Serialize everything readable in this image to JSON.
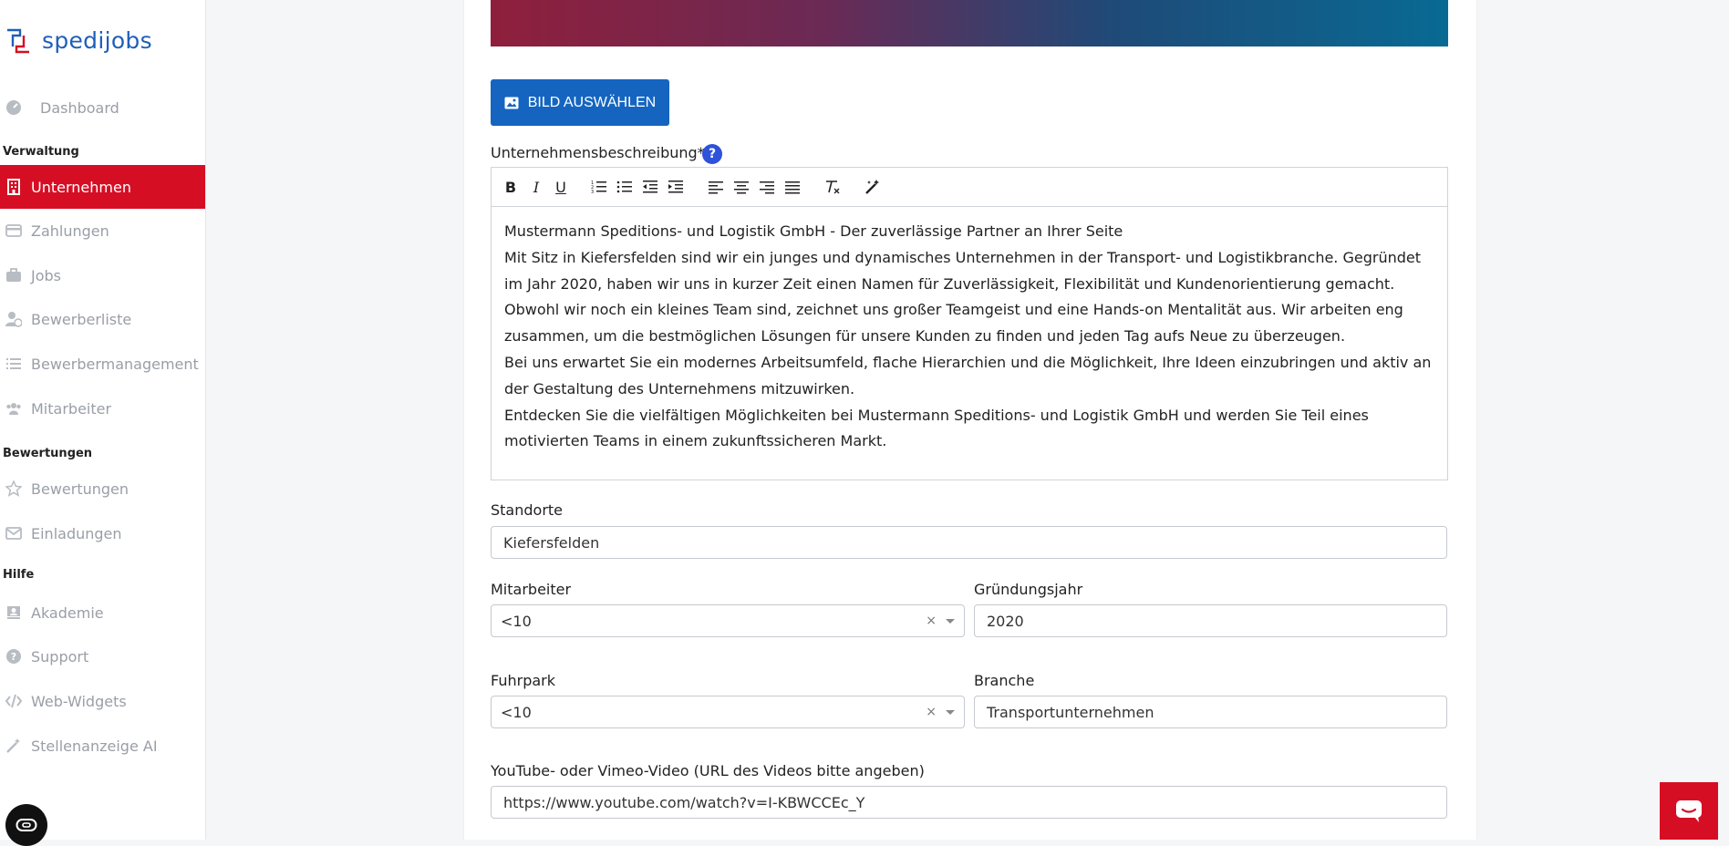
{
  "brand": {
    "name": "spedijobs",
    "accent": "#d60e24",
    "primary": "#1565c0"
  },
  "sidebar": {
    "dashboard": "Dashboard",
    "sections": {
      "verwaltung": "Verwaltung",
      "bewertungen": "Bewertungen",
      "hilfe": "Hilfe"
    },
    "items": [
      {
        "label": "Unternehmen",
        "icon": "building-icon",
        "active": true
      },
      {
        "label": "Zahlungen",
        "icon": "credit-card-icon"
      },
      {
        "label": "Jobs",
        "icon": "briefcase-icon"
      },
      {
        "label": "Bewerberliste",
        "icon": "user-clock-icon"
      },
      {
        "label": "Bewerbermanagement",
        "icon": "list-icon"
      },
      {
        "label": "Mitarbeiter",
        "icon": "users-icon"
      },
      {
        "label": "Bewertungen",
        "icon": "star-icon"
      },
      {
        "label": "Einladungen",
        "icon": "envelope-icon"
      },
      {
        "label": "Akademie",
        "icon": "graduation-cap-icon"
      },
      {
        "label": "Support",
        "icon": "question-circle-icon"
      },
      {
        "label": "Web-Widgets",
        "icon": "code-icon"
      },
      {
        "label": "Stellenanzeige AI",
        "icon": "magic-wand-icon"
      }
    ]
  },
  "form": {
    "select_image_button": "BILD AUSWÄHLEN",
    "description": {
      "label": "Unternehmensbeschreibung*",
      "help": "?",
      "paragraphs": [
        "Mustermann Speditions- und Logistik GmbH - Der zuverlässige Partner an Ihrer Seite",
        "Mit Sitz in Kiefersfelden sind wir ein junges und dynamisches Unternehmen in der Transport- und Logistikbranche. Gegründet im Jahr 2020, haben wir uns in kurzer Zeit einen Namen für Zuverlässigkeit, Flexibilität und Kundenorientierung gemacht.",
        "Obwohl wir noch ein kleines Team sind, zeichnet uns großer Teamgeist und eine Hands-on Mentalität aus. Wir arbeiten eng zusammen, um die bestmöglichen Lösungen für unsere Kunden zu finden und jeden Tag aufs Neue zu überzeugen.",
        "Bei uns erwartet Sie ein modernes Arbeitsumfeld, flache Hierarchien und die Möglichkeit, Ihre Ideen einzubringen und aktiv an der Gestaltung des Unternehmens mitzuwirken.",
        "Entdecken Sie die vielfältigen Möglichkeiten bei Mustermann Speditions- und Logistik GmbH und werden Sie Teil eines motivierten Teams in einem zukunftssicheren Markt."
      ]
    },
    "standorte": {
      "label": "Standorte",
      "value": "Kiefersfelden"
    },
    "mitarbeiter": {
      "label": "Mitarbeiter",
      "value": "<10",
      "clear": "×"
    },
    "gruendungsjahr": {
      "label": "Gründungsjahr",
      "value": "2020"
    },
    "fuhrpark": {
      "label": "Fuhrpark",
      "value": "<10",
      "clear": "×"
    },
    "branche": {
      "label": "Branche",
      "value": "Transportunternehmen"
    },
    "video": {
      "label": "YouTube- oder Vimeo-Video (URL des Videos bitte angeben)",
      "value": "https://www.youtube.com/watch?v=I-KBWCCEc_Y"
    }
  }
}
